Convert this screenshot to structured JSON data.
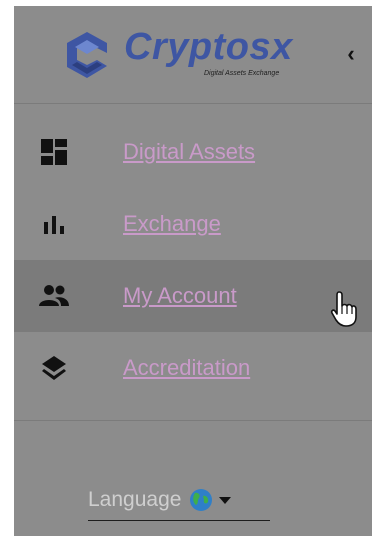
{
  "brand": {
    "name": "Cryptosx",
    "tagline": "Digital Assets Exchange",
    "color": "#3e56a3"
  },
  "header": {
    "collapse_icon": "chevron-left-icon",
    "collapse_glyph": "‹"
  },
  "menu": {
    "items": [
      {
        "label": "Digital Assets",
        "icon": "dashboard-icon"
      },
      {
        "label": "Exchange",
        "icon": "bar-chart-icon"
      },
      {
        "label": "My Account",
        "icon": "people-icon",
        "hovered": true
      },
      {
        "label": "Accreditation",
        "icon": "layers-icon"
      }
    ]
  },
  "language": {
    "label": "Language",
    "icon": "globe-icon"
  },
  "colors": {
    "panel": "#8c8c8c",
    "hover": "#7b7b7b",
    "menu_text": "#c99ac9"
  }
}
